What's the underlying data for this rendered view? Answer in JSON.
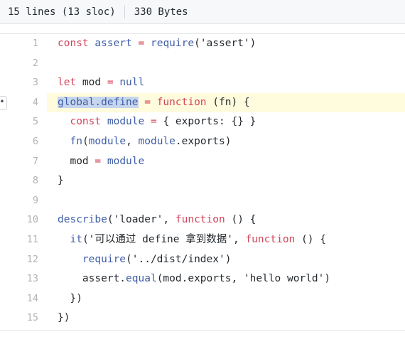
{
  "header": {
    "lines": "15 lines (13 sloc)",
    "size": "330 Bytes"
  },
  "highlighted_line": 4,
  "actions_button": "•",
  "colors": {
    "keyword": "#d0455b",
    "entity": "#3e5da6",
    "highlight": "#fffbdd",
    "selection": "#c6d6ee"
  },
  "code": [
    {
      "n": "1",
      "t": [
        [
          "k",
          "const"
        ],
        [
          "p",
          " "
        ],
        [
          "b",
          "assert"
        ],
        [
          "p",
          " "
        ],
        [
          "k",
          "="
        ],
        [
          "p",
          " "
        ],
        [
          "b",
          "require"
        ],
        [
          "p",
          "("
        ],
        [
          "s",
          "'assert'"
        ],
        [
          "p",
          ")"
        ]
      ]
    },
    {
      "n": "2",
      "t": []
    },
    {
      "n": "3",
      "t": [
        [
          "k",
          "let"
        ],
        [
          "p",
          " mod "
        ],
        [
          "k",
          "="
        ],
        [
          "p",
          " "
        ],
        [
          "b",
          "null"
        ]
      ]
    },
    {
      "n": "4",
      "t": [
        [
          "sel b",
          "global.define"
        ],
        [
          "p",
          " "
        ],
        [
          "k",
          "="
        ],
        [
          "p",
          " "
        ],
        [
          "k",
          "function"
        ],
        [
          "p",
          " (fn) {"
        ]
      ]
    },
    {
      "n": "5",
      "t": [
        [
          "p",
          "  "
        ],
        [
          "k",
          "const"
        ],
        [
          "p",
          " "
        ],
        [
          "b",
          "module"
        ],
        [
          "p",
          " "
        ],
        [
          "k",
          "="
        ],
        [
          "p",
          " { exports: {} }"
        ]
      ]
    },
    {
      "n": "6",
      "t": [
        [
          "p",
          "  "
        ],
        [
          "b",
          "fn"
        ],
        [
          "p",
          "("
        ],
        [
          "b",
          "module"
        ],
        [
          "p",
          ", "
        ],
        [
          "b",
          "module"
        ],
        [
          "p",
          ".exports)"
        ]
      ]
    },
    {
      "n": "7",
      "t": [
        [
          "p",
          "  mod "
        ],
        [
          "k",
          "="
        ],
        [
          "p",
          " "
        ],
        [
          "b",
          "module"
        ]
      ]
    },
    {
      "n": "8",
      "t": [
        [
          "p",
          "}"
        ]
      ]
    },
    {
      "n": "9",
      "t": []
    },
    {
      "n": "10",
      "t": [
        [
          "b",
          "describe"
        ],
        [
          "p",
          "("
        ],
        [
          "s",
          "'loader'"
        ],
        [
          "p",
          ", "
        ],
        [
          "k",
          "function"
        ],
        [
          "p",
          " () {"
        ]
      ]
    },
    {
      "n": "11",
      "t": [
        [
          "p",
          "  "
        ],
        [
          "b",
          "it"
        ],
        [
          "p",
          "("
        ],
        [
          "s",
          "'可以通过 define 拿到数据'"
        ],
        [
          "p",
          ", "
        ],
        [
          "k",
          "function"
        ],
        [
          "p",
          " () {"
        ]
      ]
    },
    {
      "n": "12",
      "t": [
        [
          "p",
          "    "
        ],
        [
          "b",
          "require"
        ],
        [
          "p",
          "("
        ],
        [
          "s",
          "'../dist/index'"
        ],
        [
          "p",
          ")"
        ]
      ]
    },
    {
      "n": "13",
      "t": [
        [
          "p",
          "    assert."
        ],
        [
          "b",
          "equal"
        ],
        [
          "p",
          "(mod.exports, "
        ],
        [
          "s",
          "'hello world'"
        ],
        [
          "p",
          ")"
        ]
      ]
    },
    {
      "n": "14",
      "t": [
        [
          "p",
          "  })"
        ]
      ]
    },
    {
      "n": "15",
      "t": [
        [
          "p",
          "})"
        ]
      ]
    }
  ]
}
